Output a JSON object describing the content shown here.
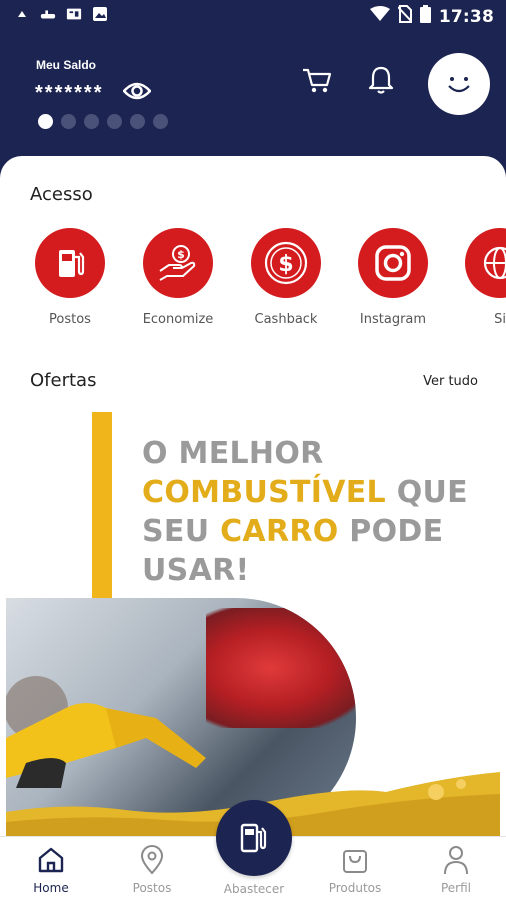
{
  "status_bar": {
    "time": "17:38",
    "left_icons": [
      "cloud-sync-icon",
      "steam-icon",
      "translate-icon",
      "image-icon"
    ],
    "right_icons": [
      "wifi-icon",
      "no-sim-icon",
      "battery-icon"
    ]
  },
  "header": {
    "balance_label": "Meu Saldo",
    "balance_value": "*******",
    "carousel_dots": 6,
    "carousel_active_index": 0
  },
  "acesso": {
    "title": "Acesso",
    "items": [
      {
        "label": "Postos",
        "icon": "fuel-pump-icon"
      },
      {
        "label": "Economize",
        "icon": "hand-coin-icon"
      },
      {
        "label": "Cashback",
        "icon": "dollar-coin-icon"
      },
      {
        "label": "Instagram",
        "icon": "instagram-icon"
      },
      {
        "label": "Si",
        "icon": "globe-icon"
      }
    ]
  },
  "ofertas": {
    "title": "Ofertas",
    "see_all": "Ver tudo",
    "banner": {
      "line1": "O MELHOR",
      "line2_highlight": "COMBUSTÍVEL",
      "line2_rest": " QUE",
      "line3_start": "SEU ",
      "line3_highlight": "CARRO",
      "line3_rest": " PODE",
      "line4": "USAR!"
    }
  },
  "bottom_nav": {
    "items": [
      {
        "label": "Home",
        "icon": "home-icon",
        "active": true
      },
      {
        "label": "Postos",
        "icon": "map-pin-icon",
        "active": false
      },
      {
        "label": "Abastecer",
        "icon": "fuel-pump-icon",
        "active": false
      },
      {
        "label": "Produtos",
        "icon": "shopping-bag-icon",
        "active": false
      },
      {
        "label": "Perfil",
        "icon": "person-icon",
        "active": false
      }
    ]
  },
  "colors": {
    "brand_navy": "#1c2452",
    "brand_red": "#d41c1f",
    "brand_yellow": "#efb51b"
  }
}
